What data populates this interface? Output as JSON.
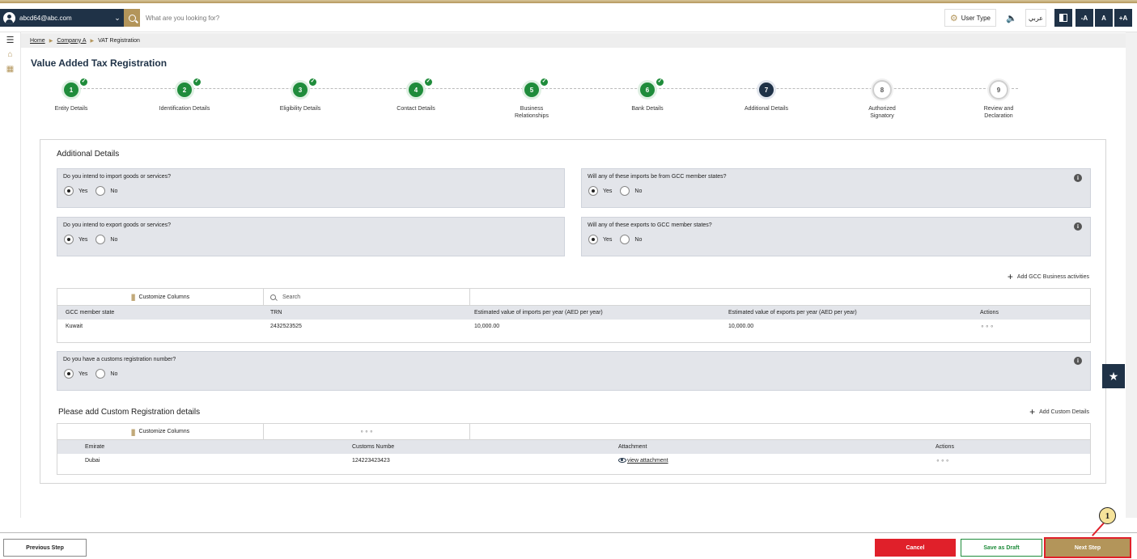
{
  "header": {
    "email": "abcd64@abc.com",
    "search_placeholder": "What are you looking for?",
    "user_type_label": "User Type",
    "language_label": "عربي",
    "font_decrease": "-A",
    "font_normal": "A",
    "font_increase": "+A"
  },
  "breadcrumb": {
    "items": [
      "Home",
      "Company A",
      "VAT Registration"
    ]
  },
  "page_title": "Value Added Tax Registration",
  "stepper": {
    "steps": [
      {
        "number": "1",
        "label": "Entity Details",
        "status": "done"
      },
      {
        "number": "2",
        "label": "Identification Details",
        "status": "done"
      },
      {
        "number": "3",
        "label": "Eligibility Details",
        "status": "done"
      },
      {
        "number": "4",
        "label": "Contact Details",
        "status": "done"
      },
      {
        "number": "5",
        "label": "Business Relationships",
        "status": "done"
      },
      {
        "number": "6",
        "label": "Bank Details",
        "status": "done"
      },
      {
        "number": "7",
        "label": "Additional Details",
        "status": "current"
      },
      {
        "number": "8",
        "label": "Authorized Signatory",
        "status": "todo"
      },
      {
        "number": "9",
        "label": "Review and Declaration",
        "status": "todo"
      }
    ]
  },
  "additional": {
    "title": "Additional Details",
    "q_import": {
      "text": "Do you intend to import goods or services?",
      "yes": "Yes",
      "no": "No",
      "selected": "Yes"
    },
    "q_import_gcc": {
      "text": "Will any of these imports be from GCC member states?",
      "yes": "Yes",
      "no": "No",
      "selected": "Yes"
    },
    "q_export": {
      "text": "Do you intend to export goods or services?",
      "yes": "Yes",
      "no": "No",
      "selected": "Yes"
    },
    "q_export_gcc": {
      "text": "Will any of these exports to GCC member states?",
      "yes": "Yes",
      "no": "No",
      "selected": "Yes"
    },
    "add_gcc_label": "Add GCC Business activities"
  },
  "gcc_table": {
    "customize_label": "Customize Columns",
    "search_placeholder": "Search",
    "columns": [
      "GCC member state",
      "TRN",
      "Estimated value of imports per year (AED per year)",
      "Estimated value of exports per year (AED per year)",
      "Actions"
    ],
    "rows": [
      {
        "state": "Kuwait",
        "trn": "2432523525",
        "imports": "10,000.00",
        "exports": "10,000.00",
        "actions": "⚬⚬⚬"
      }
    ]
  },
  "customs_question": {
    "text": "Do you have a customs registration number?",
    "yes": "Yes",
    "no": "No",
    "selected": "Yes"
  },
  "custom_section": {
    "title": "Please add Custom Registration details",
    "add_label": "Add Custom Details"
  },
  "custom_table": {
    "customize_label": "Customize Columns",
    "toolbar_dots": "⚬⚬⚬",
    "columns": [
      "Emirate",
      "Customs Numbe",
      "Attachment",
      "Actions"
    ],
    "rows": [
      {
        "emirate": "Dubai",
        "number": "124223423423",
        "attachment": "view attachment",
        "actions": "⚬⚬⚬"
      }
    ]
  },
  "footer": {
    "previous": "Previous Step",
    "cancel": "Cancel",
    "save_draft": "Save as Draft",
    "next": "Next Step"
  },
  "annotation": {
    "callout_number": "1"
  },
  "colors": {
    "navy": "#1f3247",
    "gold": "#b3955a",
    "green": "#1f8c3b",
    "red": "#e0202a",
    "panel_gray": "#e3e5ea"
  }
}
